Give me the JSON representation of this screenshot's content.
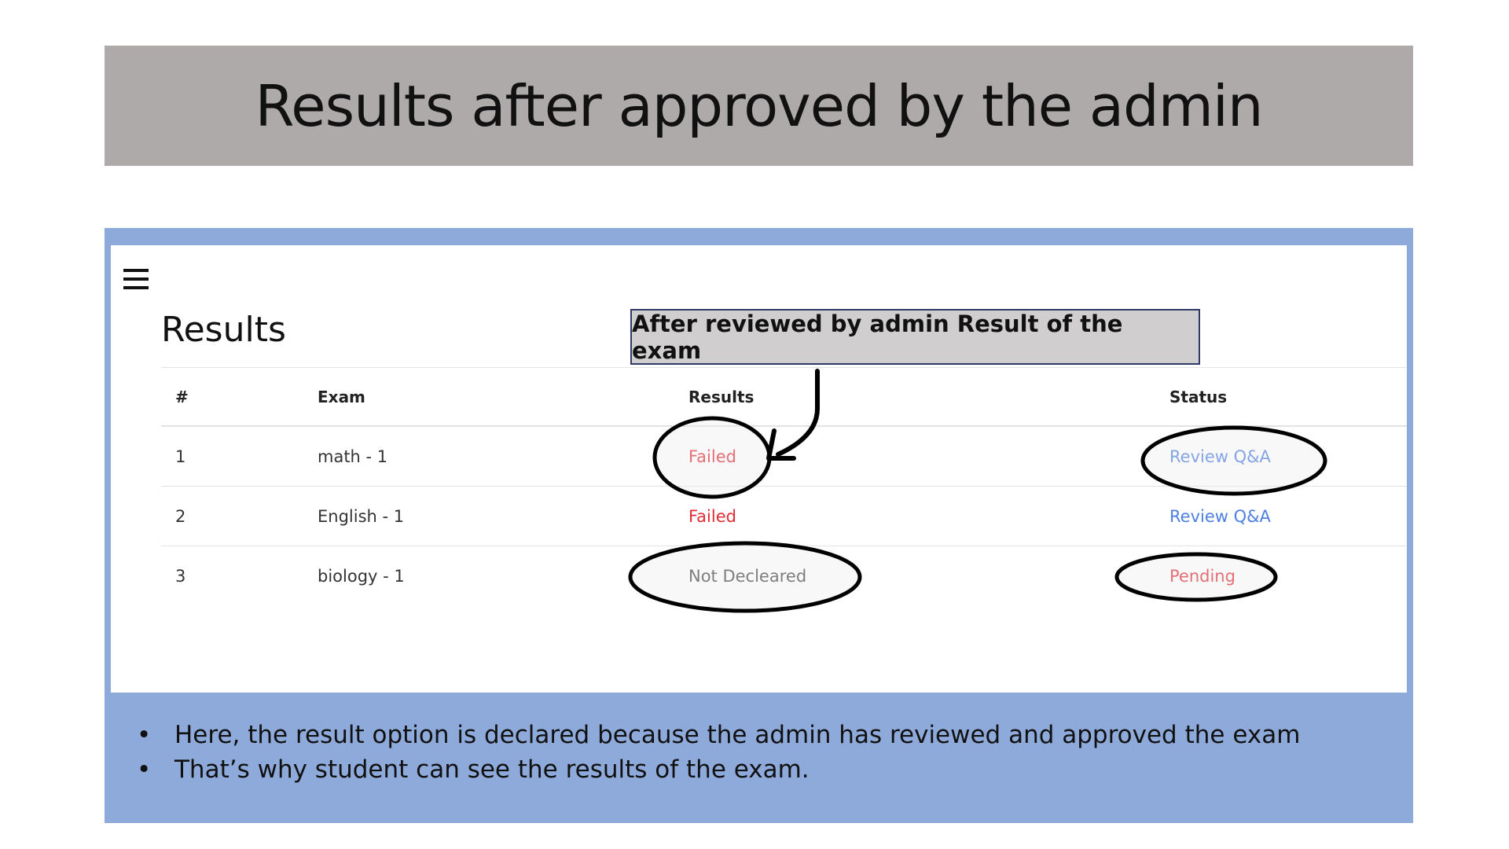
{
  "slide": {
    "title": "Results after approved by the admin"
  },
  "app": {
    "menu_icon": "hamburger-menu-icon",
    "page_title": "Results",
    "callout": "After reviewed by admin Result of the exam"
  },
  "table": {
    "headers": [
      "#",
      "Exam",
      "Results",
      "Status"
    ],
    "rows": [
      {
        "num": "1",
        "exam": "math - 1",
        "result": "Failed",
        "status": "Review Q&A"
      },
      {
        "num": "2",
        "exam": "English - 1",
        "result": "Failed",
        "status": "Review Q&A"
      },
      {
        "num": "3",
        "exam": "biology - 1",
        "result": "Not Decleared",
        "status": "Pending"
      }
    ]
  },
  "notes": [
    "Here, the result option is declared because the admin has reviewed and approved the exam",
    "That’s why student can see the results of the exam."
  ],
  "colors": {
    "banner": "#aeaaa9",
    "panel": "#8eaadb",
    "failed": "#e32b36",
    "link": "#4d7fe3",
    "pending": "#e32b36"
  }
}
